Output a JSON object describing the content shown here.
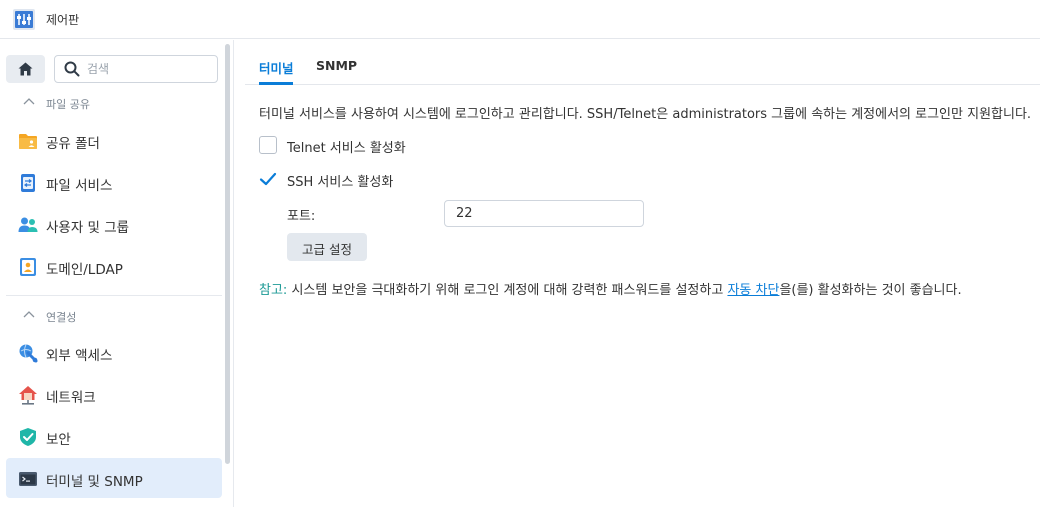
{
  "window": {
    "title": "제어판"
  },
  "sidebar": {
    "search_placeholder": "검색",
    "sections": [
      {
        "title": "파일 공유",
        "items": [
          {
            "label": "공유 폴더",
            "icon": "shared-folder-icon"
          },
          {
            "label": "파일 서비스",
            "icon": "file-services-icon"
          },
          {
            "label": "사용자 및 그룹",
            "icon": "user-group-icon"
          },
          {
            "label": "도메인/LDAP",
            "icon": "domain-ldap-icon"
          }
        ]
      },
      {
        "title": "연결성",
        "items": [
          {
            "label": "외부 액세스",
            "icon": "external-access-icon"
          },
          {
            "label": "네트워크",
            "icon": "network-icon"
          },
          {
            "label": "보안",
            "icon": "security-shield-icon"
          },
          {
            "label": "터미널 및 SNMP",
            "icon": "terminal-icon",
            "active": true
          }
        ]
      }
    ]
  },
  "main": {
    "tabs": [
      {
        "label": "터미널",
        "active": true
      },
      {
        "label": "SNMP",
        "active": false
      }
    ],
    "description": "터미널 서비스를 사용하여 시스템에 로그인하고 관리합니다. SSH/Telnet은 administrators 그룹에 속하는 계정에서의 로그인만 지원합니다.",
    "telnet": {
      "label": "Telnet 서비스 활성화",
      "checked": false
    },
    "ssh": {
      "label": "SSH 서비스 활성화",
      "checked": true
    },
    "port": {
      "label": "포트:",
      "value": "22"
    },
    "advanced_button": "고급 설정",
    "note": {
      "label": "참고:",
      "text_before": " 시스템 보안을 극대화하기 위해 로그인 계정에 대해 강력한 패스워드를 설정하고 ",
      "link": "자동 차단",
      "text_after": "을(를) 활성화하는 것이 좋습니다."
    }
  },
  "colors": {
    "accent": "#0a7dd8",
    "active_item_bg": "#e2edfb",
    "note_label": "#1d9a96"
  }
}
